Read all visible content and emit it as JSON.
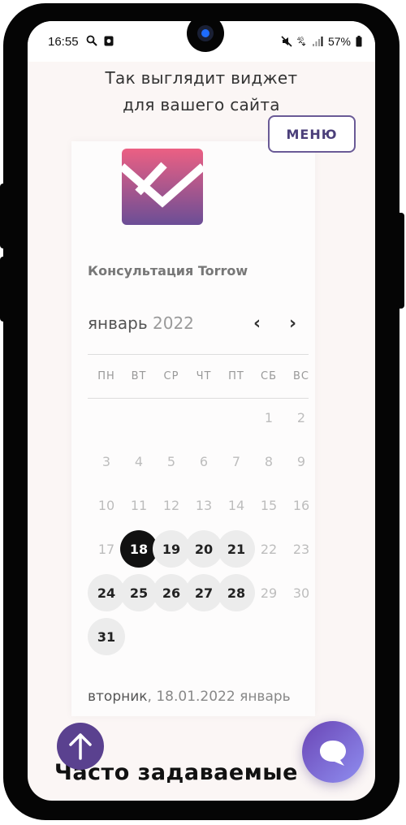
{
  "status_bar": {
    "time": "16:55",
    "battery": "57%"
  },
  "page": {
    "heading_line1": "Так выглядит виджет",
    "heading_line2": "для вашего сайта",
    "menu_label": "МЕНЮ",
    "faq_heading": "Часто задаваемые"
  },
  "widget": {
    "service_title": "Консультация Torrow",
    "month": "январь",
    "year": "2022",
    "weekdays": [
      "ПН",
      "ВТ",
      "СР",
      "ЧТ",
      "ПТ",
      "СБ",
      "ВС"
    ],
    "days": [
      {
        "n": "1",
        "state": "disabled"
      },
      {
        "n": "2",
        "state": "disabled"
      },
      {
        "n": "3",
        "state": "disabled"
      },
      {
        "n": "4",
        "state": "disabled"
      },
      {
        "n": "5",
        "state": "disabled"
      },
      {
        "n": "6",
        "state": "disabled"
      },
      {
        "n": "7",
        "state": "disabled"
      },
      {
        "n": "8",
        "state": "disabled"
      },
      {
        "n": "9",
        "state": "disabled"
      },
      {
        "n": "10",
        "state": "disabled"
      },
      {
        "n": "11",
        "state": "disabled"
      },
      {
        "n": "12",
        "state": "disabled"
      },
      {
        "n": "13",
        "state": "disabled"
      },
      {
        "n": "14",
        "state": "disabled"
      },
      {
        "n": "15",
        "state": "disabled"
      },
      {
        "n": "16",
        "state": "disabled"
      },
      {
        "n": "17",
        "state": "disabled"
      },
      {
        "n": "18",
        "state": "selected"
      },
      {
        "n": "19",
        "state": "available"
      },
      {
        "n": "20",
        "state": "available"
      },
      {
        "n": "21",
        "state": "available"
      },
      {
        "n": "22",
        "state": "disabled"
      },
      {
        "n": "23",
        "state": "disabled"
      },
      {
        "n": "24",
        "state": "available"
      },
      {
        "n": "25",
        "state": "available"
      },
      {
        "n": "26",
        "state": "available"
      },
      {
        "n": "27",
        "state": "available"
      },
      {
        "n": "28",
        "state": "available"
      },
      {
        "n": "29",
        "state": "disabled"
      },
      {
        "n": "30",
        "state": "disabled"
      },
      {
        "n": "31",
        "state": "available"
      }
    ],
    "selected_weekday": "вторник",
    "selected_date_rest": ", 18.01.2022 январь"
  },
  "colors": {
    "accent": "#5a418f",
    "logo_pink": "#ec6083",
    "logo_purple": "#6b4e96"
  }
}
